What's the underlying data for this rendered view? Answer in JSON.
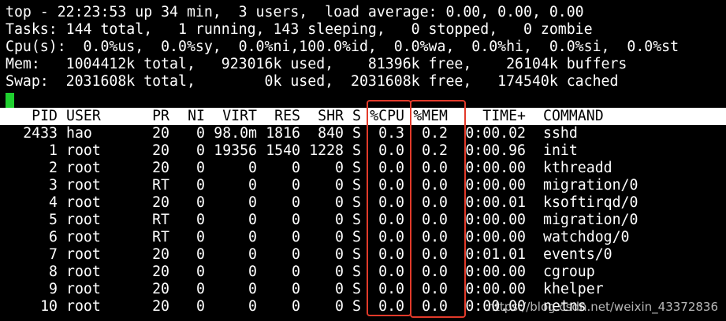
{
  "summary": {
    "line1": "top - 22:23:53 up 34 min,  3 users,  load average: 0.00, 0.00, 0.00",
    "line2": "Tasks: 144 total,   1 running, 143 sleeping,   0 stopped,   0 zombie",
    "line3": "Cpu(s):  0.0%us,  0.0%sy,  0.0%ni,100.0%id,  0.0%wa,  0.0%hi,  0.0%si,  0.0%st",
    "line4": "Mem:   1004412k total,   923016k used,    81396k free,    26104k buffers",
    "line5": "Swap:  2031608k total,        0k used,  2031608k free,   174540k cached"
  },
  "colors": {
    "cursor": "#1fcf2f",
    "highlight_box": "#e23a2a",
    "header_bg": "#ffffff"
  },
  "table": {
    "headers": {
      "pid": "PID",
      "user": "USER",
      "pr": "PR",
      "ni": "NI",
      "virt": "VIRT",
      "res": "RES",
      "shr": "SHR",
      "s": "S",
      "cpu": "%CPU",
      "mem": "%MEM",
      "time": "TIME+",
      "command": "COMMAND"
    },
    "rows": [
      {
        "pid": "2433",
        "user": "hao",
        "pr": "20",
        "ni": "0",
        "virt": "98.0m",
        "res": "1816",
        "shr": "840",
        "s": "S",
        "cpu": "0.3",
        "mem": "0.2",
        "time": "0:00.02",
        "command": "sshd"
      },
      {
        "pid": "1",
        "user": "root",
        "pr": "20",
        "ni": "0",
        "virt": "19356",
        "res": "1540",
        "shr": "1228",
        "s": "S",
        "cpu": "0.0",
        "mem": "0.2",
        "time": "0:00.96",
        "command": "init"
      },
      {
        "pid": "2",
        "user": "root",
        "pr": "20",
        "ni": "0",
        "virt": "0",
        "res": "0",
        "shr": "0",
        "s": "S",
        "cpu": "0.0",
        "mem": "0.0",
        "time": "0:00.00",
        "command": "kthreadd"
      },
      {
        "pid": "3",
        "user": "root",
        "pr": "RT",
        "ni": "0",
        "virt": "0",
        "res": "0",
        "shr": "0",
        "s": "S",
        "cpu": "0.0",
        "mem": "0.0",
        "time": "0:00.00",
        "command": "migration/0"
      },
      {
        "pid": "4",
        "user": "root",
        "pr": "20",
        "ni": "0",
        "virt": "0",
        "res": "0",
        "shr": "0",
        "s": "S",
        "cpu": "0.0",
        "mem": "0.0",
        "time": "0:00.01",
        "command": "ksoftirqd/0"
      },
      {
        "pid": "5",
        "user": "root",
        "pr": "RT",
        "ni": "0",
        "virt": "0",
        "res": "0",
        "shr": "0",
        "s": "S",
        "cpu": "0.0",
        "mem": "0.0",
        "time": "0:00.00",
        "command": "migration/0"
      },
      {
        "pid": "6",
        "user": "root",
        "pr": "RT",
        "ni": "0",
        "virt": "0",
        "res": "0",
        "shr": "0",
        "s": "S",
        "cpu": "0.0",
        "mem": "0.0",
        "time": "0:00.00",
        "command": "watchdog/0"
      },
      {
        "pid": "7",
        "user": "root",
        "pr": "20",
        "ni": "0",
        "virt": "0",
        "res": "0",
        "shr": "0",
        "s": "S",
        "cpu": "0.0",
        "mem": "0.0",
        "time": "0:01.01",
        "command": "events/0"
      },
      {
        "pid": "8",
        "user": "root",
        "pr": "20",
        "ni": "0",
        "virt": "0",
        "res": "0",
        "shr": "0",
        "s": "S",
        "cpu": "0.0",
        "mem": "0.0",
        "time": "0:00.00",
        "command": "cgroup"
      },
      {
        "pid": "9",
        "user": "root",
        "pr": "20",
        "ni": "0",
        "virt": "0",
        "res": "0",
        "shr": "0",
        "s": "S",
        "cpu": "0.0",
        "mem": "0.0",
        "time": "0:00.00",
        "command": "khelper"
      },
      {
        "pid": "10",
        "user": "root",
        "pr": "20",
        "ni": "0",
        "virt": "0",
        "res": "0",
        "shr": "0",
        "s": "S",
        "cpu": "0.0",
        "mem": "0.0",
        "time": "0:00.00",
        "command": "netns"
      }
    ]
  },
  "watermark": "https://blog.csdn.net/weixin_43372836"
}
